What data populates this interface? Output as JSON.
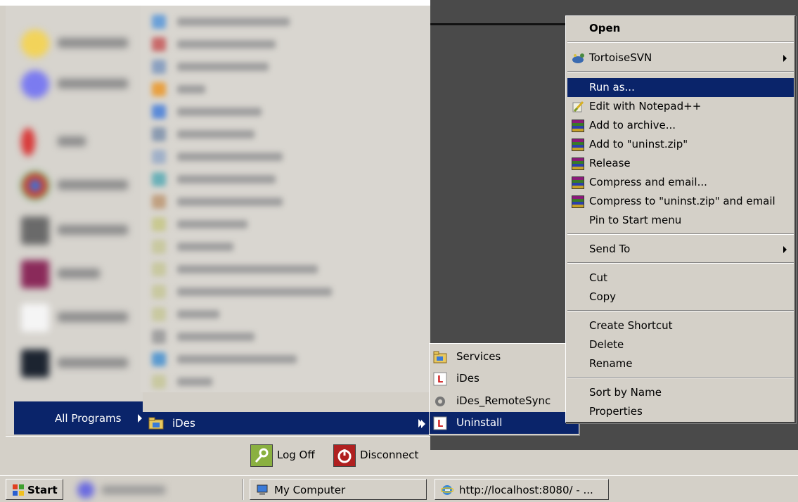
{
  "start_menu": {
    "all_programs_label": "All Programs",
    "ides_folder_label": "iDes",
    "log_off_label": "Log Off",
    "disconnect_label": "Disconnect"
  },
  "submenu": {
    "items": [
      {
        "label": "Services",
        "icon": "folder-icon"
      },
      {
        "label": "iDes",
        "icon": "ides-app-icon"
      },
      {
        "label": "iDes_RemoteSync",
        "icon": "sync-gear-icon"
      },
      {
        "label": "Uninstall",
        "icon": "ides-app-icon",
        "selected": true
      }
    ]
  },
  "context_menu": {
    "open": "Open",
    "tortoise": "TortoiseSVN",
    "run_as": "Run as...",
    "notepadpp": "Edit with Notepad++",
    "add_archive": "Add to archive...",
    "add_zip": "Add to \"uninst.zip\"",
    "release": "Release",
    "compress_email": "Compress and email...",
    "compress_zip_email": "Compress to \"uninst.zip\" and email",
    "pin_start": "Pin to Start menu",
    "send_to": "Send To",
    "cut": "Cut",
    "copy": "Copy",
    "create_shortcut": "Create Shortcut",
    "delete": "Delete",
    "rename": "Rename",
    "sort_by_name": "Sort by Name",
    "properties": "Properties"
  },
  "taskbar": {
    "start_label": "Start",
    "my_computer_label": "My Computer",
    "ie_label": "http://localhost:8080/ - ..."
  },
  "colors": {
    "selection": "#0a246a",
    "menu_face": "#d4d0c8"
  }
}
